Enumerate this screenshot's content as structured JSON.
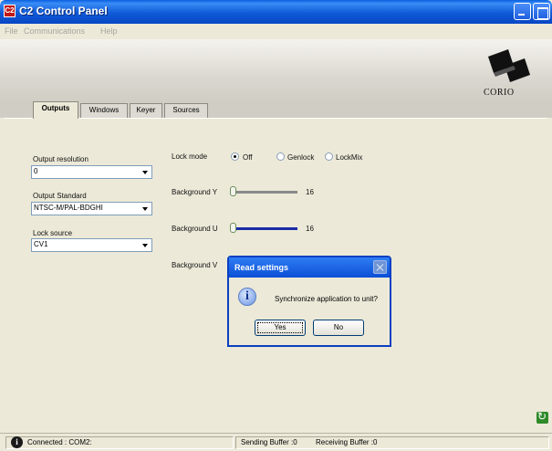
{
  "window": {
    "title": "C2 Control Panel",
    "icon_text": "C2"
  },
  "menu": {
    "items": [
      "File",
      "Communications",
      "Help"
    ]
  },
  "brand": {
    "logo_text": "CORIO"
  },
  "tabs": [
    {
      "label": "Outputs",
      "active": true
    },
    {
      "label": "Windows",
      "active": false
    },
    {
      "label": "Keyer",
      "active": false
    },
    {
      "label": "Sources",
      "active": false
    }
  ],
  "outputs": {
    "output_resolution": {
      "label": "Output resolution",
      "value": "0"
    },
    "output_standard": {
      "label": "Output Standard",
      "value": "NTSC-M/PAL-BDGHI"
    },
    "lock_source": {
      "label": "Lock source",
      "value": "CV1"
    },
    "lock_mode": {
      "label": "Lock mode",
      "options": [
        "Off",
        "Genlock",
        "LockMix"
      ],
      "selected": "Off"
    },
    "background_y": {
      "label": "Background Y",
      "value": "16",
      "track_color": "#8a8a8a"
    },
    "background_u": {
      "label": "Background U",
      "value": "16",
      "track_color": "#1a2aa8"
    },
    "background_v": {
      "label": "Background V"
    }
  },
  "dialog": {
    "title": "Read settings",
    "message": "Synchronize application to unit?",
    "icon": "information-icon",
    "yes_label": "Yes",
    "no_label": "No"
  },
  "statusbar": {
    "connection": "Connected :  COM2:",
    "sending": "Sending Buffer :0",
    "receiving": "Receiving Buffer :0"
  },
  "colors": {
    "titlebar": "#0a5fe0",
    "window_bg": "#ece9d8",
    "dialog_border": "#0a3fc2"
  }
}
